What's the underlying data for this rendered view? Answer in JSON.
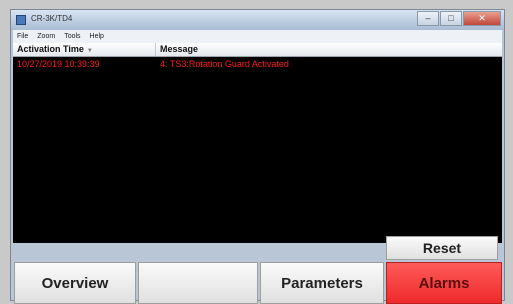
{
  "window": {
    "title": "CR-3K/TD4",
    "controls": [
      "–",
      "□",
      "✕"
    ]
  },
  "menu": [
    "File",
    "Zoom",
    "Tools",
    "Help"
  ],
  "alarm_list": {
    "columns": [
      "Activation Time",
      "Message"
    ],
    "rows": [
      {
        "time": "10/27/2019 10:39:39",
        "message": "4: TS3:Rotation Guard Activated"
      }
    ]
  },
  "buttons": {
    "reset": "Reset",
    "overview": "Overview",
    "blank": "",
    "parameters": "Parameters",
    "alarms": "Alarms"
  },
  "colors": {
    "alarm_text": "#ff1a1a",
    "alarms_active": "#ee2a2a",
    "list_background": "#000000"
  }
}
